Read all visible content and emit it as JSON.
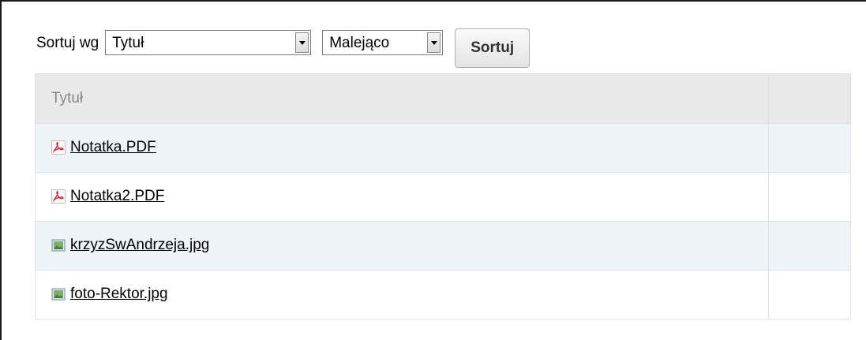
{
  "sortbar": {
    "label": "Sortuj wg",
    "field_select": {
      "selected": "Tytuł"
    },
    "order_select": {
      "selected": "Malejąco"
    },
    "button_label": "Sortuj"
  },
  "table": {
    "header": {
      "title": "Tytuł",
      "extra": ""
    },
    "rows": [
      {
        "name": "Notatka.PDF",
        "icon": "pdf-icon"
      },
      {
        "name": "Notatka2.PDF",
        "icon": "pdf-icon"
      },
      {
        "name": "krzyzSwAndrzeja.jpg",
        "icon": "image-icon"
      },
      {
        "name": "foto-Rektor.jpg",
        "icon": "image-icon"
      }
    ]
  },
  "colors": {
    "header_bg": "#e9e9e9",
    "row_alt_bg": "#eef3f8",
    "pdf_icon": "#cc2020",
    "image_icon": "#5a8a4a"
  }
}
